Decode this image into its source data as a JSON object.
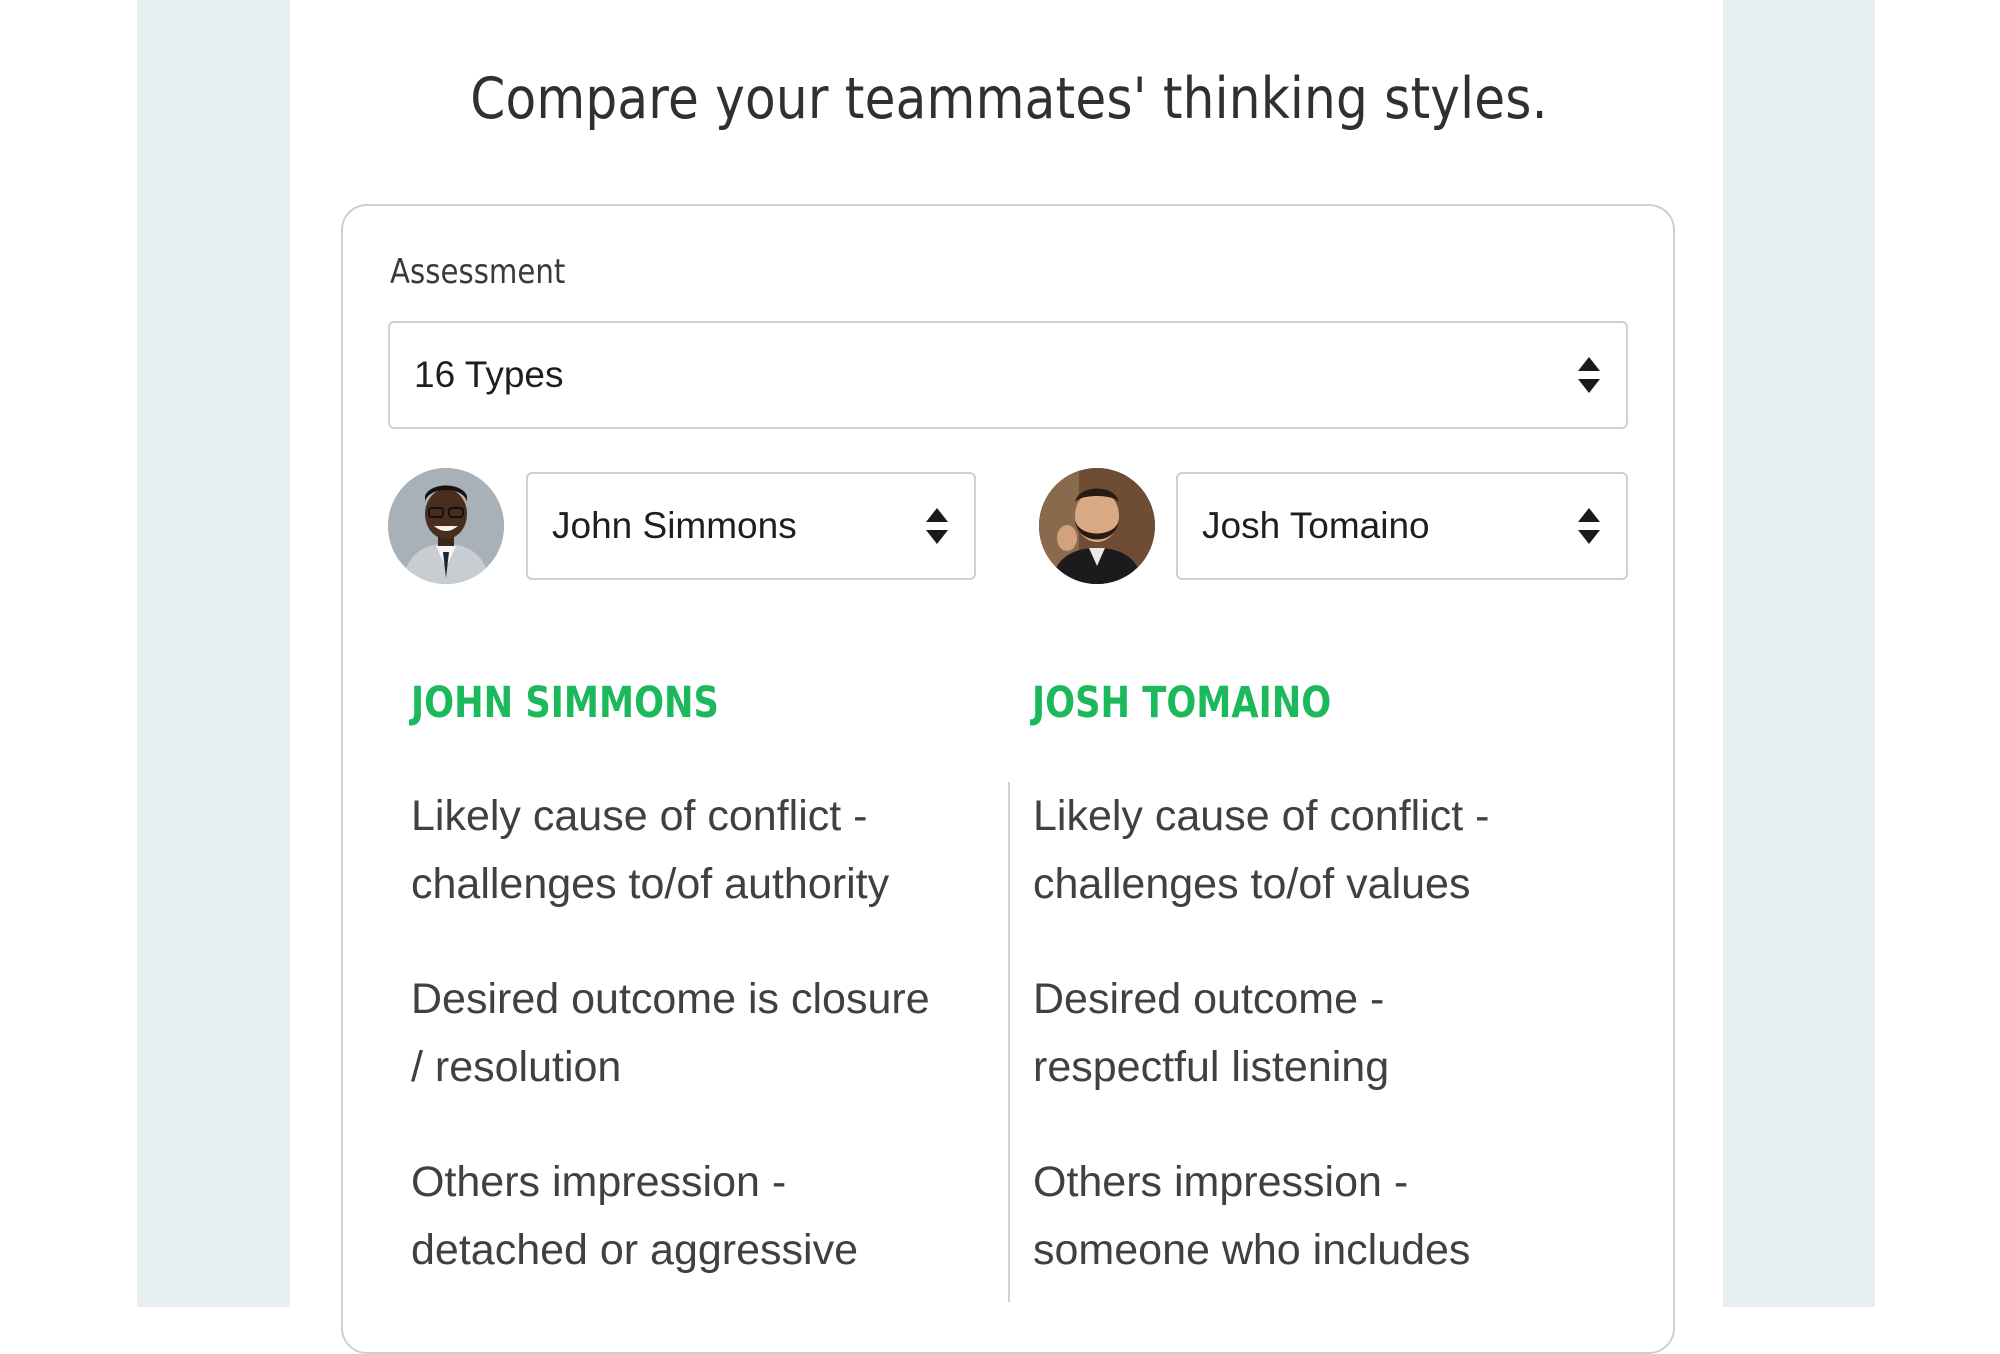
{
  "page": {
    "title": "Compare your teammates' thinking styles."
  },
  "assessment": {
    "label": "Assessment",
    "selected": "16 Types"
  },
  "teammates": [
    {
      "select_value": "John Simmons",
      "heading": "JOHN SIMMONS",
      "traits": [
        [
          "Likely cause of conflict -",
          "challenges to/of authority"
        ],
        [
          "Desired outcome is closure",
          "/ resolution"
        ],
        [
          "Others impression -",
          "detached or aggressive"
        ]
      ]
    },
    {
      "select_value": "Josh Tomaino",
      "heading": "JOSH TOMAINO",
      "traits": [
        [
          "Likely cause of conflict -",
          "challenges to/of values"
        ],
        [
          "Desired outcome -",
          "respectful listening"
        ],
        [
          "Others impression -",
          "someone who includes"
        ]
      ]
    }
  ],
  "colors": {
    "accent_green": "#1cb85c",
    "background_band": "#e7eff0",
    "border": "#cfcfcf"
  },
  "icons": {
    "select_arrows": "sort-arrows-icon",
    "avatar": "user-photo"
  }
}
